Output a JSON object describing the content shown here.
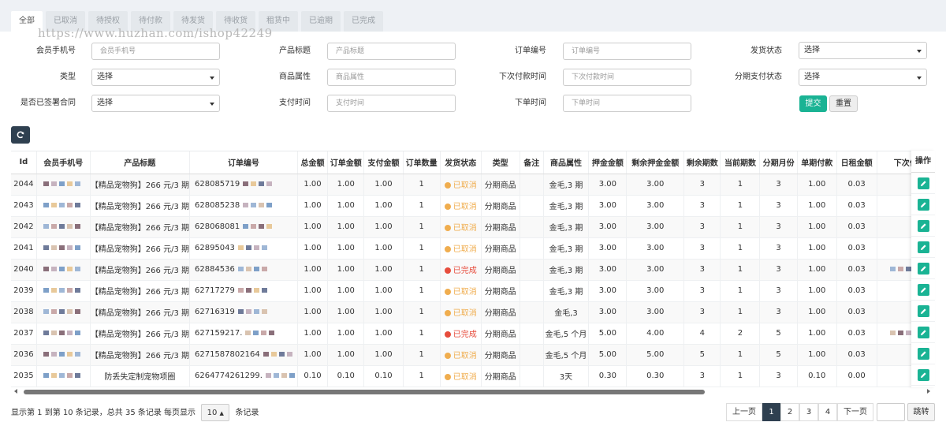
{
  "tabs": [
    {
      "label": "全部",
      "active": true
    },
    {
      "label": "已取消"
    },
    {
      "label": "待授权"
    },
    {
      "label": "待付款"
    },
    {
      "label": "待发货"
    },
    {
      "label": "待收货"
    },
    {
      "label": "租赁中"
    },
    {
      "label": "已逾期"
    },
    {
      "label": "已完成"
    }
  ],
  "watermark": "https://www.huzhan.com/ishop42249",
  "filters": {
    "member_phone": {
      "label": "会员手机号",
      "placeholder": "会员手机号"
    },
    "product_title": {
      "label": "产品标题",
      "placeholder": "产品标题"
    },
    "order_no": {
      "label": "订单编号",
      "placeholder": "订单编号"
    },
    "ship_status": {
      "label": "发货状态",
      "value": "选择"
    },
    "type": {
      "label": "类型",
      "value": "选择"
    },
    "goods_attr": {
      "label": "商品属性",
      "placeholder": "商品属性"
    },
    "next_pay_time": {
      "label": "下次付款时间",
      "placeholder": "下次付款时间"
    },
    "installment_status": {
      "label": "分期支付状态",
      "value": "选择"
    },
    "contract_signed": {
      "label": "是否已签署合同",
      "value": "选择"
    },
    "pay_time": {
      "label": "支付时间",
      "placeholder": "支付时间"
    },
    "order_time": {
      "label": "下单时间",
      "placeholder": "下单时间"
    },
    "submit_label": "提交",
    "reset_label": "重置"
  },
  "table": {
    "headers": [
      "Id",
      "会员手机号",
      "产品标题",
      "订单编号",
      "总金额",
      "订单金额",
      "支付金额",
      "订单数量",
      "发货状态",
      "类型",
      "备注",
      "商品属性",
      "押金金额",
      "剩余押金金额",
      "剩余期数",
      "当前期数",
      "分期月份",
      "单期付款",
      "日租金额",
      "下次付"
    ],
    "ops_header": "操作",
    "rows": [
      {
        "id": "2044",
        "title": "【精品宠物狗】266 元/3 期",
        "order": "628085719",
        "total": "1.00",
        "order_amt": "1.00",
        "paid": "1.00",
        "qty": "1",
        "status": "已取消",
        "status_kind": "cancel",
        "type": "分期商品",
        "note": "",
        "attr": "金毛,3 期",
        "deposit": "3.00",
        "rem_deposit": "3.00",
        "rem_periods": "3",
        "cur_period": "1",
        "months": "3",
        "per_pay": "1.00",
        "daily": "0.03"
      },
      {
        "id": "2043",
        "title": "【精品宠物狗】266 元/3 期",
        "order": "628085238",
        "total": "1.00",
        "order_amt": "1.00",
        "paid": "1.00",
        "qty": "1",
        "status": "已取消",
        "status_kind": "cancel",
        "type": "分期商品",
        "note": "",
        "attr": "金毛,3 期",
        "deposit": "3.00",
        "rem_deposit": "3.00",
        "rem_periods": "3",
        "cur_period": "1",
        "months": "3",
        "per_pay": "1.00",
        "daily": "0.03"
      },
      {
        "id": "2042",
        "title": "【精品宠物狗】266 元/3 期",
        "order": "628068081",
        "total": "1.00",
        "order_amt": "1.00",
        "paid": "1.00",
        "qty": "1",
        "status": "已取消",
        "status_kind": "cancel",
        "type": "分期商品",
        "note": "",
        "attr": "金毛,3 期",
        "deposit": "3.00",
        "rem_deposit": "3.00",
        "rem_periods": "3",
        "cur_period": "1",
        "months": "3",
        "per_pay": "1.00",
        "daily": "0.03"
      },
      {
        "id": "2041",
        "title": "【精品宠物狗】266 元/3 期",
        "order": "62895043",
        "total": "1.00",
        "order_amt": "1.00",
        "paid": "1.00",
        "qty": "1",
        "status": "已取消",
        "status_kind": "cancel",
        "type": "分期商品",
        "note": "",
        "attr": "金毛,3 期",
        "deposit": "3.00",
        "rem_deposit": "3.00",
        "rem_periods": "3",
        "cur_period": "1",
        "months": "3",
        "per_pay": "1.00",
        "daily": "0.03"
      },
      {
        "id": "2040",
        "title": "【精品宠物狗】266 元/3 期",
        "order": "62884536",
        "total": "1.00",
        "order_amt": "1.00",
        "paid": "1.00",
        "qty": "1",
        "status": "已完成",
        "status_kind": "done",
        "type": "分期商品",
        "note": "",
        "attr": "金毛,3 期",
        "deposit": "3.00",
        "rem_deposit": "3.00",
        "rem_periods": "3",
        "cur_period": "1",
        "months": "3",
        "per_pay": "1.00",
        "daily": "0.03"
      },
      {
        "id": "2039",
        "title": "【精品宠物狗】266 元/3 期",
        "order": "62717279",
        "total": "1.00",
        "order_amt": "1.00",
        "paid": "1.00",
        "qty": "1",
        "status": "已取消",
        "status_kind": "cancel",
        "type": "分期商品",
        "note": "",
        "attr": "金毛,3 期",
        "deposit": "3.00",
        "rem_deposit": "3.00",
        "rem_periods": "3",
        "cur_period": "1",
        "months": "3",
        "per_pay": "1.00",
        "daily": "0.03"
      },
      {
        "id": "2038",
        "title": "【精品宠物狗】266 元/3 期",
        "order": "62716319",
        "total": "1.00",
        "order_amt": "1.00",
        "paid": "1.00",
        "qty": "1",
        "status": "已取消",
        "status_kind": "cancel",
        "type": "分期商品",
        "note": "",
        "attr": "金毛,3",
        "deposit": "3.00",
        "rem_deposit": "3.00",
        "rem_periods": "3",
        "cur_period": "1",
        "months": "3",
        "per_pay": "1.00",
        "daily": "0.03"
      },
      {
        "id": "2037",
        "title": "【精品宠物狗】266 元/3 期",
        "order": "627159217.",
        "total": "1.00",
        "order_amt": "1.00",
        "paid": "1.00",
        "qty": "1",
        "status": "已完成",
        "status_kind": "done",
        "type": "分期商品",
        "note": "",
        "attr": "金毛,5 个月",
        "deposit": "5.00",
        "rem_deposit": "4.00",
        "rem_periods": "4",
        "cur_period": "2",
        "months": "5",
        "per_pay": "1.00",
        "daily": "0.03"
      },
      {
        "id": "2036",
        "title": "【精品宠物狗】266 元/3 期",
        "order": "6271587802164",
        "total": "1.00",
        "order_amt": "1.00",
        "paid": "1.00",
        "qty": "1",
        "status": "已取消",
        "status_kind": "cancel",
        "type": "分期商品",
        "note": "",
        "attr": "金毛,5 个月",
        "deposit": "5.00",
        "rem_deposit": "5.00",
        "rem_periods": "5",
        "cur_period": "1",
        "months": "5",
        "per_pay": "1.00",
        "daily": "0.03"
      },
      {
        "id": "2035",
        "title": "防丢失定制宠物项圈",
        "order": "6264774261299.",
        "total": "0.10",
        "order_amt": "0.10",
        "paid": "0.10",
        "qty": "1",
        "status": "已取消",
        "status_kind": "cancel",
        "type": "分期商品",
        "note": "",
        "attr": "3天",
        "deposit": "0.30",
        "rem_deposit": "0.30",
        "rem_periods": "3",
        "cur_period": "1",
        "months": "3",
        "per_pay": "0.10",
        "daily": "0.00"
      }
    ]
  },
  "footer": {
    "info_prefix": "显示第 1 到第 10 条记录，总共 35 条记录 每页显示",
    "page_size": "10",
    "info_suffix": "条记录",
    "prev_label": "上一页",
    "next_label": "下一页",
    "pages": [
      "1",
      "2",
      "3",
      "4"
    ],
    "current_page": "1",
    "jump_label": "跳转"
  },
  "colors": {
    "accent": "#1ab394",
    "dark": "#2f4050",
    "cancel": "#f0ad4e",
    "done": "#e74c3c"
  },
  "icons": {
    "refresh": "refresh-icon",
    "edit": "edit-icon",
    "caret": "chevron-down-icon"
  }
}
